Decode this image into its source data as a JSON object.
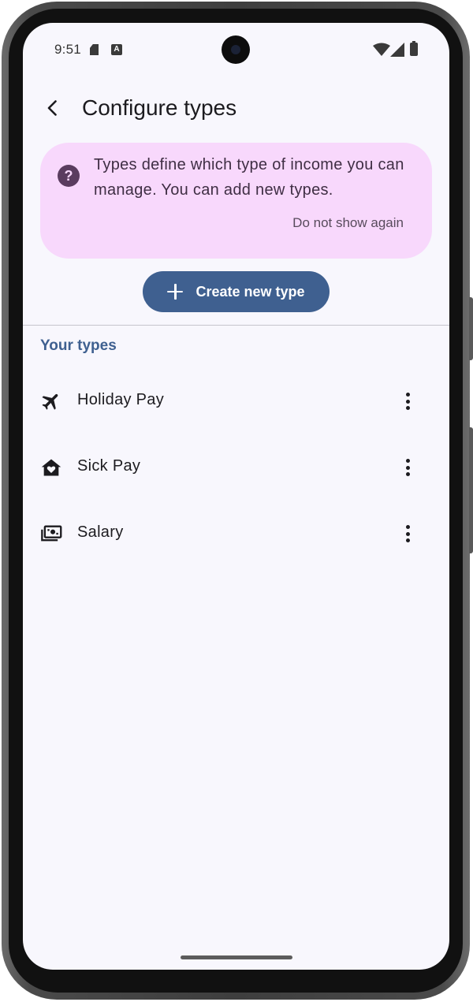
{
  "status_bar": {
    "time": "9:51",
    "a_badge": "A",
    "icons": [
      "sd-card-icon",
      "a-notification-icon",
      "wifi-icon",
      "cell-signal-icon",
      "battery-icon"
    ]
  },
  "app_bar": {
    "title": "Configure types",
    "back_icon": "arrow-back-icon"
  },
  "info_card": {
    "icon": "help-icon",
    "icon_glyph": "?",
    "text": "Types define which type of income you can manage. You can add new types.",
    "dismiss_label": "Do not show again",
    "background": "#f8d8fc"
  },
  "create_button": {
    "label": "Create new type",
    "icon": "plus-icon",
    "background": "#3f6090"
  },
  "section": {
    "title": "Your types",
    "color": "#3f6090"
  },
  "types": [
    {
      "label": "Holiday Pay",
      "icon": "airplane-icon"
    },
    {
      "label": "Sick Pay",
      "icon": "home-heart-icon"
    },
    {
      "label": "Salary",
      "icon": "payments-icon"
    }
  ]
}
